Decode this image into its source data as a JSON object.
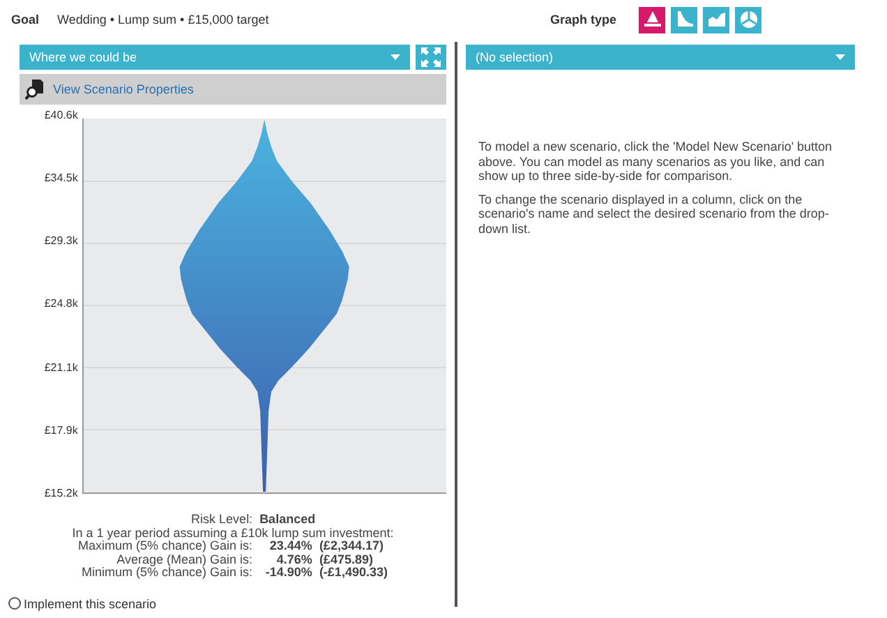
{
  "goal": {
    "label": "Goal",
    "value": "Wedding • Lump sum • £15,000 target"
  },
  "graph_type": {
    "label": "Graph type",
    "options": [
      {
        "selected": true
      },
      {
        "selected": false
      },
      {
        "selected": false
      },
      {
        "selected": false
      }
    ]
  },
  "left_column": {
    "scenario": "Where we could be",
    "properties_link": "View Scenario Properties",
    "y_axis_labels": [
      "£40.6k",
      "£34.5k",
      "£29.3k",
      "£24.8k",
      "£21.1k",
      "£17.9k",
      "£15.2k"
    ],
    "risk": {
      "label": "Risk Level:",
      "value": "Balanced"
    },
    "period_note": "In a 1 year period assuming a £10k lump sum investment:",
    "gains": [
      {
        "label": "Maximum (5% chance) Gain is:",
        "percent": "23.44%",
        "amount": "(£2,344.17)"
      },
      {
        "label": "Average (Mean) Gain is:",
        "percent": "4.76%",
        "amount": "(£475.89)"
      },
      {
        "label": "Minimum (5% chance) Gain is:",
        "percent": "-14.90%",
        "amount": "(-£1,490.33)"
      }
    ],
    "implement": {
      "label": "Implement this scenario",
      "selected": false
    }
  },
  "right_column": {
    "scenario": "(No selection)",
    "paragraphs": [
      "To model a new scenario, click the 'Model New Scenario' button above. You can model as many scenarios as you like, and can show up to three side-by-side for comparison.",
      "To change the scenario displayed in a column, click on the scenario's name and select the desired scenario from the drop-down list."
    ]
  }
}
